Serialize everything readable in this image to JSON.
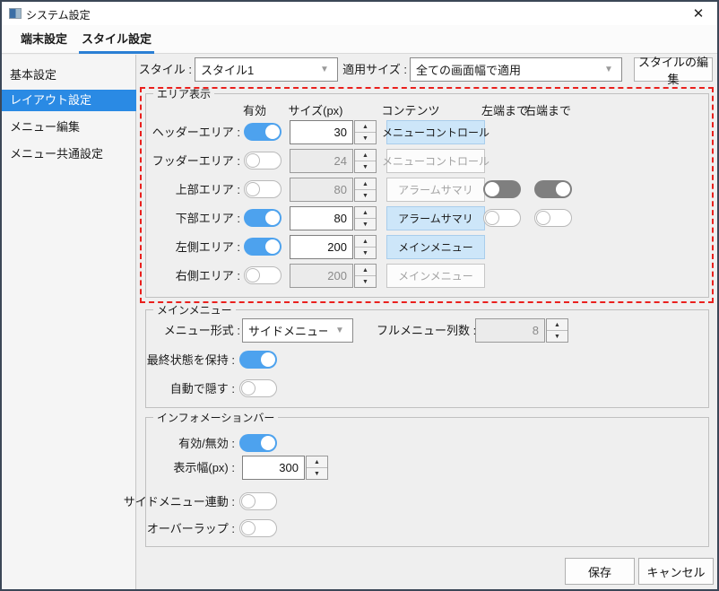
{
  "window": {
    "title": "システム設定"
  },
  "icons": {
    "close": "✕",
    "dropdown": "▼",
    "spin_up": "▲",
    "spin_down": "▼"
  },
  "tabs": [
    {
      "label": "端末設定",
      "active": false
    },
    {
      "label": "スタイル設定",
      "active": true
    }
  ],
  "sidebar": {
    "items": [
      {
        "label": "基本設定",
        "selected": false
      },
      {
        "label": "レイアウト設定",
        "selected": true
      },
      {
        "label": "メニュー編集",
        "selected": false
      },
      {
        "label": "メニュー共通設定",
        "selected": false
      }
    ]
  },
  "style_row": {
    "style_label": "スタイル :",
    "style_value": "スタイル1",
    "apply_label": "適用サイズ :",
    "apply_value": "全ての画面幅で適用",
    "edit_button": "スタイルの編集"
  },
  "area": {
    "group_title": "エリア表示",
    "columns": {
      "enabled": "有効",
      "size": "サイズ(px)",
      "content": "コンテンツ",
      "to_left": "左端まで",
      "to_right": "右端まで"
    },
    "rows": [
      {
        "label": "ヘッダーエリア :",
        "toggle": "on",
        "size": "30",
        "size_enabled": true,
        "content": "メニューコントロール",
        "content_active": true
      },
      {
        "label": "フッダーエリア :",
        "toggle": "off",
        "size": "24",
        "size_enabled": false,
        "content": "メニューコントロール",
        "content_active": false
      },
      {
        "label": "上部エリア :",
        "toggle": "off",
        "size": "80",
        "size_enabled": false,
        "content": "アラームサマリ",
        "content_active": false,
        "to_left": "gray-off",
        "to_right": "gray-on"
      },
      {
        "label": "下部エリア :",
        "toggle": "on",
        "size": "80",
        "size_enabled": true,
        "content": "アラームサマリ",
        "content_active": true,
        "to_left": "off",
        "to_right": "off"
      },
      {
        "label": "左側エリア :",
        "toggle": "on",
        "size": "200",
        "size_enabled": true,
        "content": "メインメニュー",
        "content_active": true
      },
      {
        "label": "右側エリア :",
        "toggle": "off",
        "size": "200",
        "size_enabled": false,
        "content": "メインメニュー",
        "content_active": false
      }
    ]
  },
  "main_menu": {
    "group_title": "メインメニュー",
    "format_label": "メニュー形式 :",
    "format_value": "サイドメニュー",
    "columns_label": "フルメニュー列数 :",
    "columns_value": "8",
    "columns_enabled": false,
    "keep_state_label": "最終状態を保持 :",
    "keep_state_toggle": "on",
    "auto_hide_label": "自動で隠す :",
    "auto_hide_toggle": "off"
  },
  "info_bar": {
    "group_title": "インフォメーションバー",
    "enabled_label": "有効/無効 :",
    "enabled_toggle": "on",
    "width_label": "表示幅(px) :",
    "width_value": "300",
    "side_link_label": "サイドメニュー連動 :",
    "side_link_toggle": "off",
    "overlap_label": "オーバーラップ :",
    "overlap_toggle": "off"
  },
  "footer": {
    "save": "保存",
    "cancel": "キャンセル"
  },
  "colors": {
    "toggle_on_blue": "#4da2ee",
    "sidebar_selection_blue": "#2a8ae4",
    "tab_underline_blue": "#2a7fd4",
    "highlight_red": "#e9201d",
    "content_active_bg": "#cde6f9",
    "window_border": "#3b4757"
  }
}
